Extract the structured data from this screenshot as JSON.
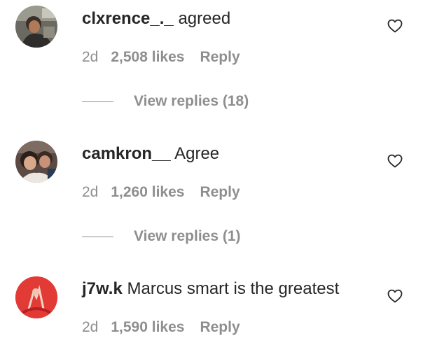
{
  "comments": [
    {
      "username": "clxrence_._",
      "text": "agreed",
      "time": "2d",
      "likes": "2,508 likes",
      "reply": "Reply",
      "view_replies": "View replies (18)"
    },
    {
      "username": "camkron__",
      "text": "Agree",
      "time": "2d",
      "likes": "1,260 likes",
      "reply": "Reply",
      "view_replies": "View replies (1)"
    },
    {
      "username": "j7w.k",
      "text": "Marcus smart is the greatest",
      "time": "2d",
      "likes": "1,590 likes",
      "reply": "Reply"
    }
  ],
  "icons": {
    "like": "heart-outline-icon"
  },
  "colors": {
    "primary_text": "#262626",
    "secondary_text": "#8e8e8e"
  }
}
